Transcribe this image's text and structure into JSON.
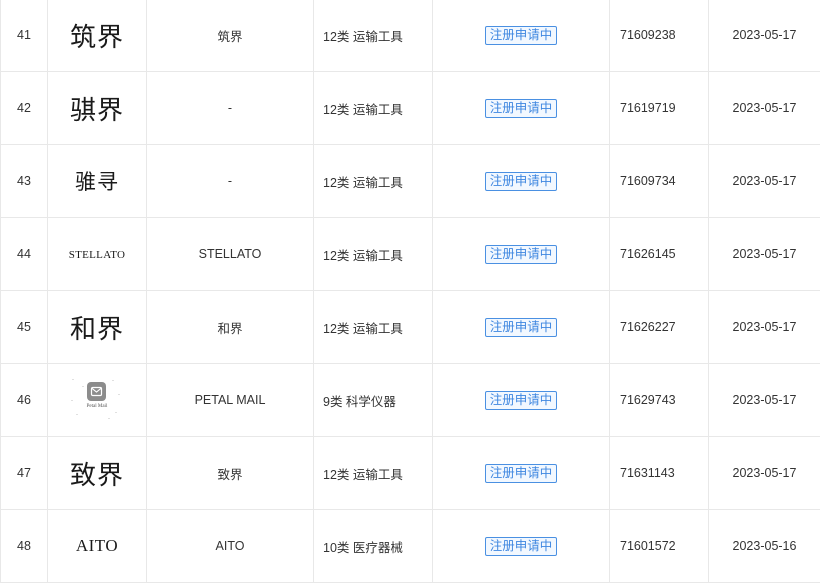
{
  "rows": [
    {
      "no": "41",
      "logo": "筑界",
      "name": "筑界",
      "class": "12类 运输工具",
      "status": "注册申请中",
      "reg_no": "71609238",
      "date": "2023-05-17"
    },
    {
      "no": "42",
      "logo": "骐界",
      "name": "-",
      "class": "12类 运输工具",
      "status": "注册申请中",
      "reg_no": "71619719",
      "date": "2023-05-17"
    },
    {
      "no": "43",
      "logo": "骓寻",
      "name": "-",
      "class": "12类 运输工具",
      "status": "注册申请中",
      "reg_no": "71609734",
      "date": "2023-05-17"
    },
    {
      "no": "44",
      "logo": "STELLATO",
      "name": "STELLATO",
      "class": "12类 运输工具",
      "status": "注册申请中",
      "reg_no": "71626145",
      "date": "2023-05-17"
    },
    {
      "no": "45",
      "logo": "和界",
      "name": "和界",
      "class": "12类 运输工具",
      "status": "注册申请中",
      "reg_no": "71626227",
      "date": "2023-05-17"
    },
    {
      "no": "46",
      "logo": "Petal Mail",
      "name": "PETAL MAIL",
      "class": "9类 科学仪器",
      "status": "注册申请中",
      "reg_no": "71629743",
      "date": "2023-05-17"
    },
    {
      "no": "47",
      "logo": "致界",
      "name": "致界",
      "class": "12类 运输工具",
      "status": "注册申请中",
      "reg_no": "71631143",
      "date": "2023-05-17"
    },
    {
      "no": "48",
      "logo": "AITO",
      "name": "AITO",
      "class": "10类 医疗器械",
      "status": "注册申请中",
      "reg_no": "71601572",
      "date": "2023-05-16"
    }
  ],
  "colors": {
    "status_border": "#4a90e2",
    "status_text": "#3f87e0",
    "grid_line": "#e8e8e8"
  },
  "icons": {
    "petal_mail_logo": "mail-app-icon"
  }
}
